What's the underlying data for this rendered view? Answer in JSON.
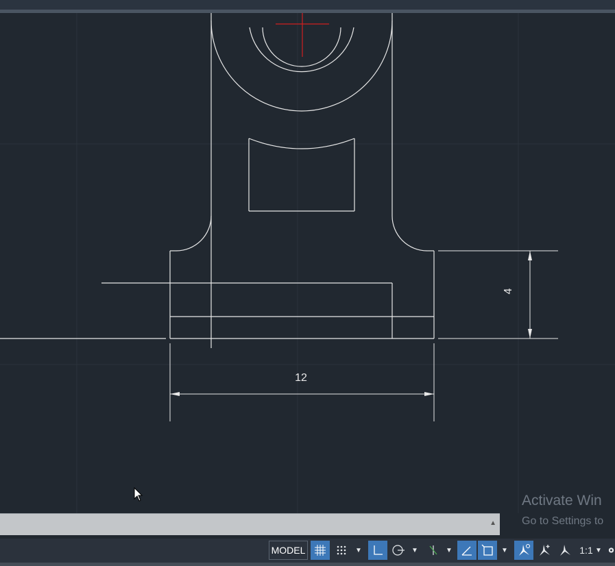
{
  "drawing": {
    "dimension_horizontal": "12",
    "dimension_vertical": "4"
  },
  "watermark": {
    "title": "Activate Win",
    "subtitle": "Go to Settings to"
  },
  "command_line": {
    "value": "",
    "expand_arrow": "▲"
  },
  "statusbar": {
    "model_label": "MODEL",
    "scale_label": "1:1",
    "icons": [
      "grid-icon",
      "snap-icon",
      "ortho-icon",
      "polar-icon",
      "osnap-tracking-icon",
      "isodraft-icon",
      "ucs-icon",
      "annotation-visibility-icon",
      "auto-scale-icon",
      "annotation-scale-icon",
      "gear-icon"
    ]
  },
  "colors": {
    "background": "#212830",
    "geometry": "#e8e8e8",
    "center_mark": "#d01f1f",
    "active_toggle": "#3d78b8"
  }
}
